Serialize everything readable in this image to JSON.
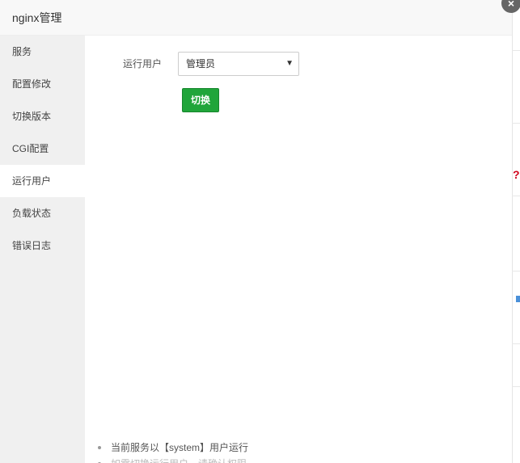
{
  "dialog": {
    "title": "nginx管理",
    "close_label": "×"
  },
  "sidebar": {
    "items": [
      {
        "label": "服务"
      },
      {
        "label": "配置修改"
      },
      {
        "label": "切换版本"
      },
      {
        "label": "CGI配置"
      },
      {
        "label": "运行用户",
        "active": true
      },
      {
        "label": "负载状态"
      },
      {
        "label": "错误日志"
      }
    ]
  },
  "run_user": {
    "label": "运行用户",
    "selected": "管理员",
    "switch_label": "切换"
  },
  "tips": [
    "当前服务以【system】用户运行",
    "如需切换运行用户，请确认权限"
  ]
}
